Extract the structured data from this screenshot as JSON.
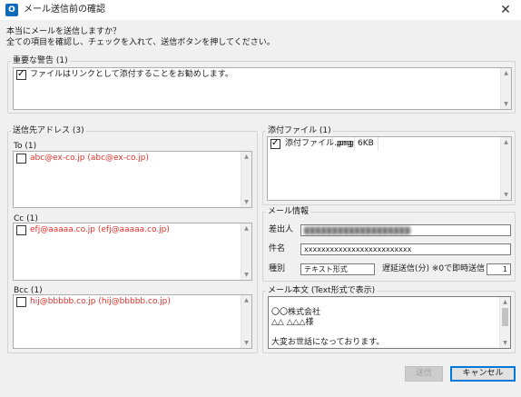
{
  "window": {
    "title": "メール送信前の確認",
    "app_icon_letter": "O",
    "close_glyph": "✕"
  },
  "intro": {
    "line1": "本当にメールを送信しますか？",
    "line2": "全ての項目を確認し、チェックを入れて、送信ボタンを押してください。"
  },
  "warning": {
    "group_label": "重要な警告 (1)",
    "items": [
      {
        "checked": true,
        "text": "ファイルはリンクとして添付することをお勧めします。"
      }
    ]
  },
  "recipients": {
    "group_label": "送信先アドレス (3)",
    "to": {
      "label": "To (1)",
      "items": [
        {
          "checked": false,
          "text": "abc@ex-co.jp (abc@ex-co.jp)"
        }
      ]
    },
    "cc": {
      "label": "Cc (1)",
      "items": [
        {
          "checked": false,
          "text": "efj@aaaaa.co.jp (efj@aaaaa.co.jp)"
        }
      ]
    },
    "bcc": {
      "label": "Bcc (1)",
      "items": [
        {
          "checked": false,
          "text": "hij@bbbbb.co.jp (hij@bbbbb.co.jp)"
        }
      ]
    }
  },
  "attachments": {
    "group_label": "添付ファイル (1)",
    "items": [
      {
        "checked": true,
        "name": "添付ファイル.png",
        "ext": ".png",
        "size": "6KB"
      }
    ]
  },
  "mail_info": {
    "group_label": "メール情報",
    "sender_label": "差出人",
    "sender_value": "▇▇▇▇▇▇▇▇▇▇▇▇▇▇▇▇▇▇▇",
    "subject_label": "件名",
    "subject_value": "xxxxxxxxxxxxxxxxxxxxxxxxx",
    "type_label": "種別",
    "type_value": "テキスト形式",
    "delay_label": "遅延送信(分) ※0で即時送信",
    "delay_value": "1"
  },
  "body": {
    "group_label": "メール本文 (Text形式で表示)",
    "lines": [
      "",
      "〇〇株式会社",
      "△△ △△△様",
      "",
      "大変お世話になっております。"
    ]
  },
  "buttons": {
    "send_label": "送信",
    "cancel_label": "キャンセル"
  },
  "colors": {
    "accent": "#0078d7",
    "recipient_text": "#e0312b",
    "outlook_blue": "#0f6cbd"
  },
  "icons": {
    "app": "outlook-icon",
    "close": "close-icon",
    "scroll_up": "scroll-up-arrow-icon",
    "scroll_down": "scroll-down-arrow-icon"
  }
}
